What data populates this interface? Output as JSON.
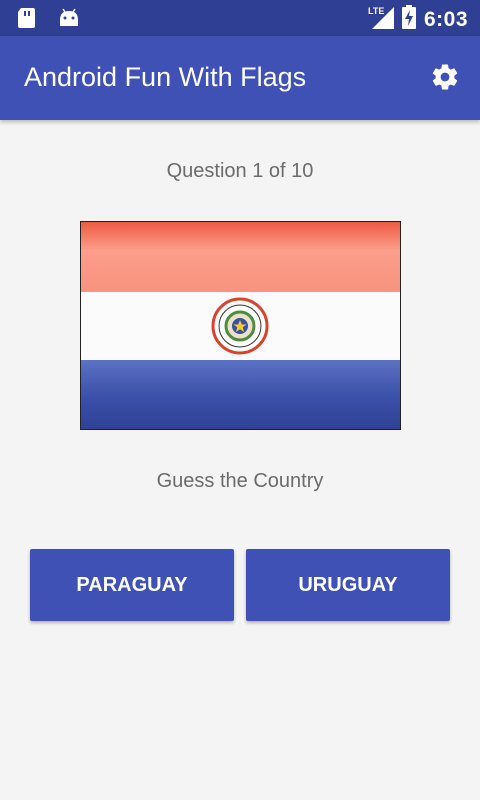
{
  "status_bar": {
    "network_label": "LTE",
    "time": "6:03",
    "icons": [
      "sd-card-icon",
      "android-icon",
      "signal-icon",
      "battery-charging-icon"
    ]
  },
  "app_bar": {
    "title": "Android Fun With Flags",
    "settings_icon": "gear-icon"
  },
  "quiz": {
    "question_label": "Question 1 of 10",
    "flag_country": "Paraguay",
    "prompt": "Guess the Country",
    "answers": [
      "PARAGUAY",
      "URUGUAY"
    ]
  },
  "colors": {
    "primary": "#3f51b5",
    "primary_dark": "#2f3f93",
    "background": "#f4f4f4",
    "text_secondary": "#6b6b6b"
  }
}
